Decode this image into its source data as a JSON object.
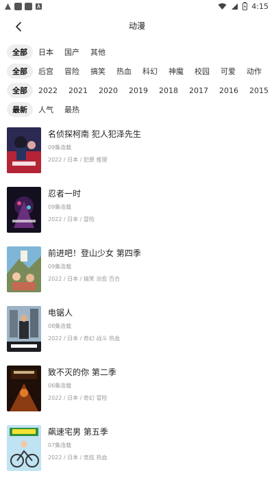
{
  "status_bar": {
    "time": "4:15",
    "icons": [
      "warning-icon",
      "app-icon",
      "app-icon",
      "app-icon",
      "wifi-icon",
      "signal-icon",
      "battery-icon"
    ]
  },
  "header": {
    "title": "动漫",
    "back_icon": "chevron-left-icon"
  },
  "filters": {
    "row1": [
      "全部",
      "日本",
      "国产",
      "其他"
    ],
    "row2": [
      "全部",
      "后宫",
      "冒险",
      "搞笑",
      "热血",
      "科幻",
      "神魔",
      "校园",
      "可爱",
      "动作"
    ],
    "row3": [
      "全部",
      "2022",
      "2021",
      "2020",
      "2019",
      "2018",
      "2017",
      "2016",
      "2015"
    ],
    "row4": [
      "最新",
      "人气",
      "最热"
    ]
  },
  "colors": {
    "active_chip_bg": "#eeeeee",
    "text_primary": "#222222",
    "text_secondary": "#999999"
  },
  "items": [
    {
      "title": "名侦探柯南 犯人犯泽先生",
      "episodes": "09集连载",
      "meta": "2022 / 日本 / 犯罪 推理"
    },
    {
      "title": "忍者一时",
      "episodes": "09集连载",
      "meta": "2022 / 日本 / 冒险"
    },
    {
      "title": "前进吧！登山少女 第四季",
      "episodes": "09集连载",
      "meta": "2022 / 日本 / 搞笑 治愈 百合"
    },
    {
      "title": "电锯人",
      "episodes": "08集连载",
      "meta": "2022 / 日本 / 奇幻 战斗 热血"
    },
    {
      "title": "致不灭的你 第二季",
      "episodes": "06集连载",
      "meta": "2022 / 日本 / 奇幻 冒险"
    },
    {
      "title": "飙速宅男 第五季",
      "episodes": "07集连载",
      "meta": "2022 / 日本 / 竞技 热血"
    }
  ]
}
